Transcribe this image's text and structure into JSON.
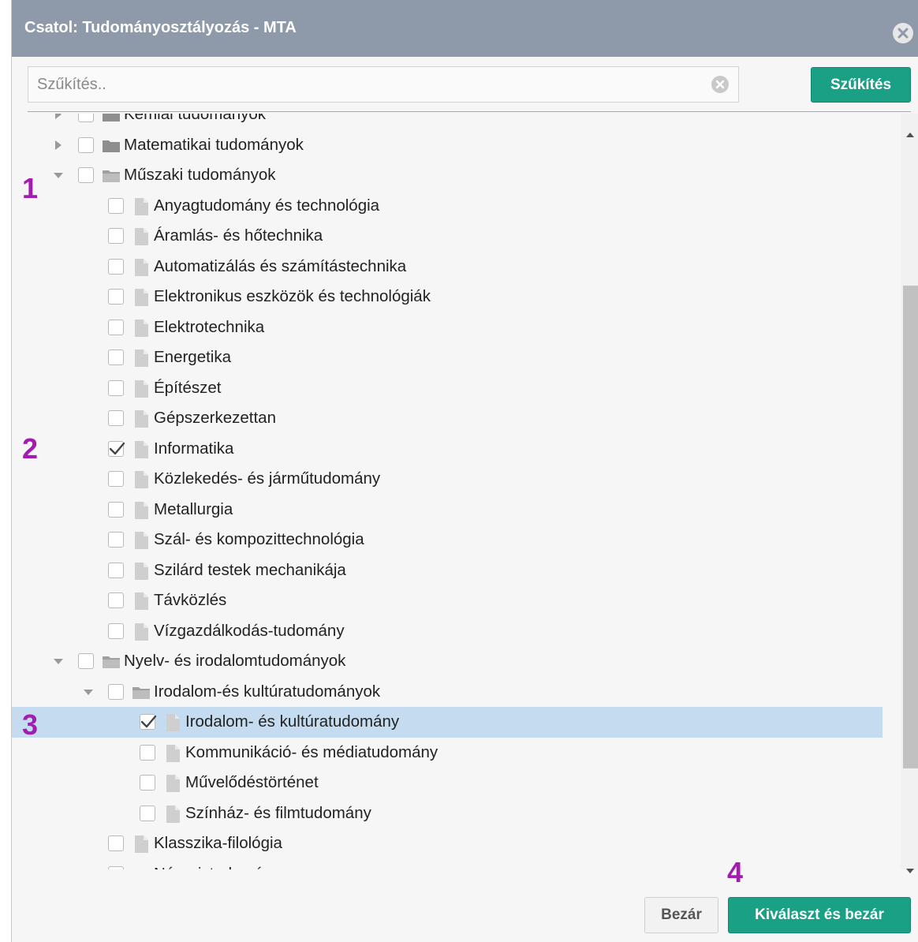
{
  "dialog": {
    "title": "Csatol: Tudományosztályozás - MTA",
    "close_icon": "close-circle-icon"
  },
  "search": {
    "placeholder": "Szűkítés..",
    "value": "",
    "clear_icon": "clear-circle-icon",
    "button_label": "Szűkítés"
  },
  "tree": [
    {
      "label": "Kémiai tudományok",
      "level": 0,
      "type": "folder",
      "expander": "collapsed",
      "checked": false
    },
    {
      "label": "Matematikai tudományok",
      "level": 0,
      "type": "folder",
      "expander": "collapsed",
      "checked": false
    },
    {
      "label": "Műszaki tudományok",
      "level": 0,
      "type": "folder-open",
      "expander": "expanded",
      "checked": false
    },
    {
      "label": "Anyagtudomány és technológia",
      "level": 1,
      "type": "file",
      "checked": false
    },
    {
      "label": "Áramlás- és hőtechnika",
      "level": 1,
      "type": "file",
      "checked": false
    },
    {
      "label": "Automatizálás és számítástechnika",
      "level": 1,
      "type": "file",
      "checked": false
    },
    {
      "label": "Elektronikus eszközök és technológiák",
      "level": 1,
      "type": "file",
      "checked": false
    },
    {
      "label": "Elektrotechnika",
      "level": 1,
      "type": "file",
      "checked": false
    },
    {
      "label": "Energetika",
      "level": 1,
      "type": "file",
      "checked": false
    },
    {
      "label": "Építészet",
      "level": 1,
      "type": "file",
      "checked": false
    },
    {
      "label": "Gépszerkezettan",
      "level": 1,
      "type": "file",
      "checked": false
    },
    {
      "label": "Informatika",
      "level": 1,
      "type": "file",
      "checked": true
    },
    {
      "label": "Közlekedés- és járműtudomány",
      "level": 1,
      "type": "file",
      "checked": false
    },
    {
      "label": "Metallurgia",
      "level": 1,
      "type": "file",
      "checked": false
    },
    {
      "label": "Szál- és kompozittechnológia",
      "level": 1,
      "type": "file",
      "checked": false
    },
    {
      "label": "Szilárd testek mechanikája",
      "level": 1,
      "type": "file",
      "checked": false
    },
    {
      "label": "Távközlés",
      "level": 1,
      "type": "file",
      "checked": false
    },
    {
      "label": "Vízgazdálkodás-tudomány",
      "level": 1,
      "type": "file",
      "checked": false
    },
    {
      "label": "Nyelv- és irodalomtudományok",
      "level": 0,
      "type": "folder-open",
      "expander": "expanded",
      "checked": false
    },
    {
      "label": "Irodalom-és kultúratudományok",
      "level": 1,
      "type": "folder-open",
      "expander": "expanded",
      "checked": false
    },
    {
      "label": "Irodalom- és kultúratudomány",
      "level": 2,
      "type": "file",
      "checked": true,
      "selected": true
    },
    {
      "label": "Kommunikáció- és médiatudomány",
      "level": 2,
      "type": "file",
      "checked": false
    },
    {
      "label": "Művelődéstörténet",
      "level": 2,
      "type": "file",
      "checked": false
    },
    {
      "label": "Színház- és filmtudomány",
      "level": 2,
      "type": "file",
      "checked": false
    },
    {
      "label": "Klasszika-filológia",
      "level": 1,
      "type": "file",
      "checked": false
    },
    {
      "label": "Néprajztudomány",
      "level": 1,
      "type": "folder",
      "expander": "collapsed",
      "checked": false
    }
  ],
  "footer": {
    "close_label": "Bezár",
    "select_close_label": "Kiválaszt és bezár"
  },
  "markers": [
    "1",
    "2",
    "3",
    "4"
  ],
  "colors": {
    "title_bar": "#8e9aaa",
    "accent_green": "#1aa085",
    "selected_row": "#c5dcf0",
    "marker_purple": "#a21caf"
  }
}
